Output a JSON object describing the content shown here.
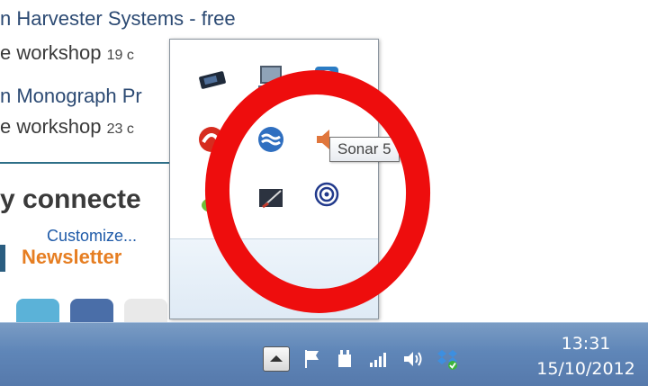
{
  "webpage": {
    "items": [
      {
        "title": "n Harvester Systems - free",
        "meta": "e workshop",
        "date": "19 c"
      },
      {
        "title": "n Monograph Pr",
        "meta": "e workshop",
        "date": "23 c"
      }
    ],
    "heading": "y connecte",
    "newsletter": "Newsletter"
  },
  "flyout": {
    "icons": [
      "graphics-tablet-icon",
      "monitor-icon",
      "network-globe-icon",
      "red-antivirus-icon",
      "blue-wave-icon",
      "speaker-icon",
      "green-figure-icon",
      "pen-display-icon",
      "sonar-icon"
    ],
    "customize_label": "Customize..."
  },
  "tooltip": {
    "text": "Sonar 5"
  },
  "taskbar": {
    "time": "13:31",
    "date": "15/10/2012",
    "tray_icons": [
      "flag-icon",
      "power-plug-icon",
      "signal-bars-icon",
      "volume-icon",
      "dropbox-icon"
    ]
  },
  "colors": {
    "annotation_ring": "#ee0d0d",
    "taskbar": "#5f86b8",
    "link": "#2c4a73",
    "newsletter": "#e67e22"
  }
}
